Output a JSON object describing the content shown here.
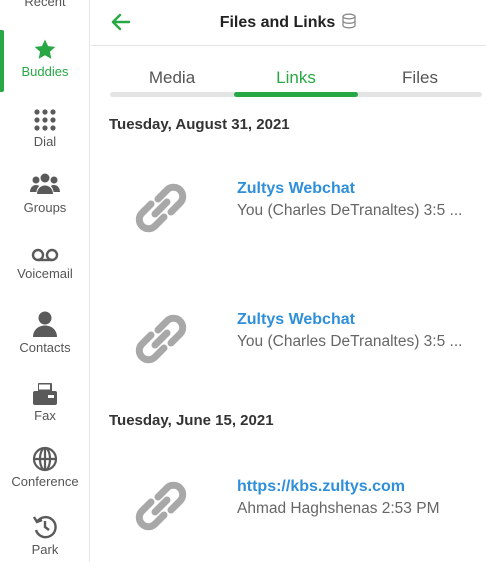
{
  "sidebar": {
    "items": [
      {
        "id": "recent",
        "label": "Recent",
        "icon": "clock-icon"
      },
      {
        "id": "buddies",
        "label": "Buddies",
        "icon": "star-icon",
        "active": true
      },
      {
        "id": "dial",
        "label": "Dial",
        "icon": "dialpad-icon"
      },
      {
        "id": "groups",
        "label": "Groups",
        "icon": "group-icon"
      },
      {
        "id": "voicemail",
        "label": "Voicemail",
        "icon": "voicemail-icon"
      },
      {
        "id": "contacts",
        "label": "Contacts",
        "icon": "contact-icon"
      },
      {
        "id": "fax",
        "label": "Fax",
        "icon": "fax-icon"
      },
      {
        "id": "conference",
        "label": "Conference",
        "icon": "globe-icon"
      },
      {
        "id": "park",
        "label": "Park",
        "icon": "park-icon"
      }
    ]
  },
  "header": {
    "title": "Files and Links"
  },
  "tabs": [
    {
      "label": "Media"
    },
    {
      "label": "Links",
      "active": true
    },
    {
      "label": "Files"
    }
  ],
  "groups": [
    {
      "date": "Tuesday, August 31, 2021",
      "items": [
        {
          "title": "Zultys Webchat",
          "subtitle": "You (Charles DeTranaltes) 3:5 ..."
        },
        {
          "title": "Zultys Webchat",
          "subtitle": "You (Charles DeTranaltes) 3:5 ..."
        }
      ]
    },
    {
      "date": "Tuesday, June 15, 2021",
      "items": [
        {
          "title": "https://kbs.zultys.com",
          "subtitle": "Ahmad Haghshenas 2:53 PM"
        }
      ]
    }
  ],
  "colors": {
    "accent": "#27a844",
    "link": "#2f8fd8",
    "icon_gray": "#5a5a5a",
    "link_icon_gray": "#a8a8a8"
  }
}
